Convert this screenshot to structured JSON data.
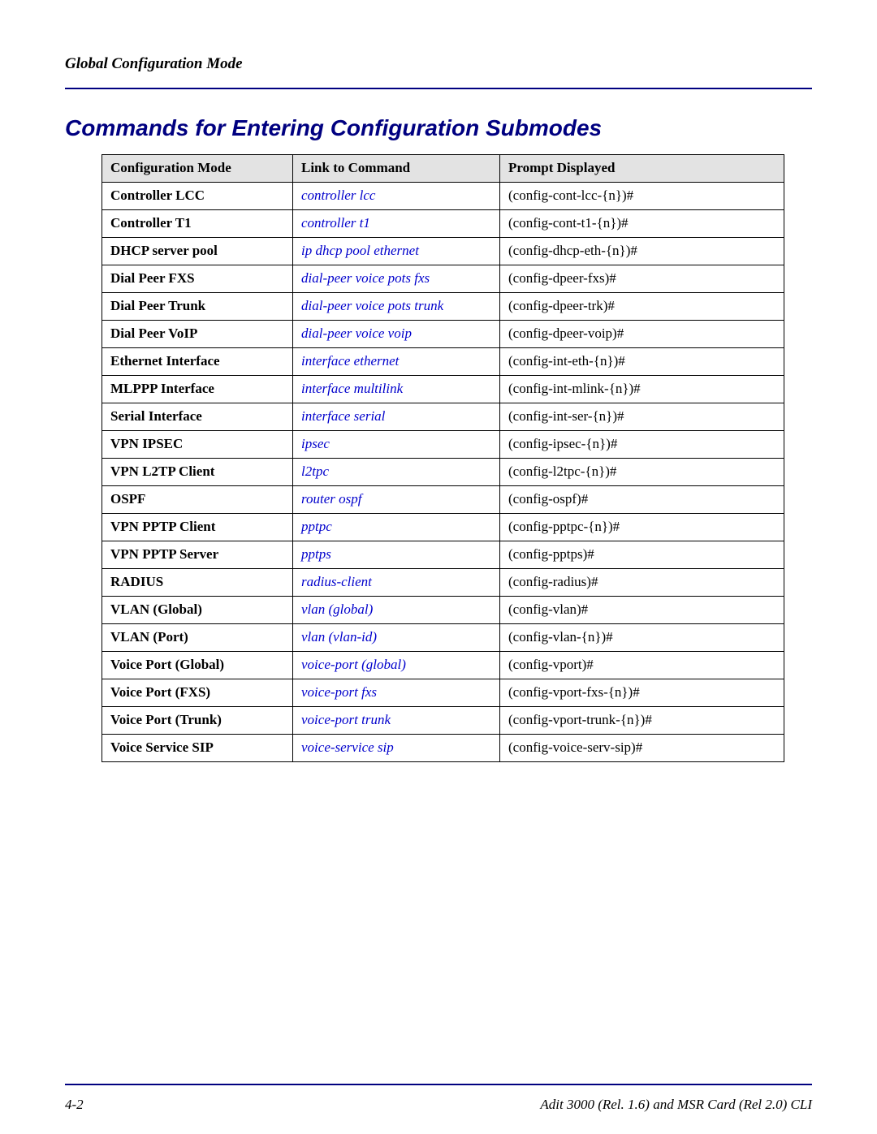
{
  "header": {
    "title": "Global Configuration Mode"
  },
  "section": {
    "heading": "Commands for Entering Configuration Submodes"
  },
  "table": {
    "headers": [
      "Configuration Mode",
      "Link to Command",
      "Prompt Displayed"
    ],
    "rows": [
      {
        "mode": "Controller LCC",
        "link": "controller lcc",
        "prompt": "(config-cont-lcc-{n})#"
      },
      {
        "mode": "Controller T1",
        "link": "controller t1",
        "prompt": "(config-cont-t1-{n})#"
      },
      {
        "mode": "DHCP server pool",
        "link": "ip dhcp pool ethernet",
        "prompt": "(config-dhcp-eth-{n})#"
      },
      {
        "mode": "Dial Peer FXS",
        "link": "dial-peer voice pots fxs",
        "prompt": "(config-dpeer-fxs)#"
      },
      {
        "mode": "Dial Peer Trunk",
        "link": "dial-peer voice pots trunk",
        "prompt": "(config-dpeer-trk)#"
      },
      {
        "mode": "Dial Peer VoIP",
        "link": "dial-peer voice voip",
        "prompt": "(config-dpeer-voip)#"
      },
      {
        "mode": "Ethernet Interface",
        "link": "interface ethernet",
        "prompt": "(config-int-eth-{n})#"
      },
      {
        "mode": "MLPPP Interface",
        "link": "interface multilink",
        "prompt": "(config-int-mlink-{n})#"
      },
      {
        "mode": "Serial Interface",
        "link": "interface serial",
        "prompt": "(config-int-ser-{n})#"
      },
      {
        "mode": "VPN IPSEC",
        "link": "ipsec",
        "prompt": "(config-ipsec-{n})#"
      },
      {
        "mode": "VPN L2TP Client",
        "link": "l2tpc",
        "prompt": "(config-l2tpc-{n})#"
      },
      {
        "mode": "OSPF",
        "link": "router ospf",
        "prompt": "(config-ospf)#"
      },
      {
        "mode": "VPN PPTP Client",
        "link": "pptpc",
        "prompt": "(config-pptpc-{n})#"
      },
      {
        "mode": "VPN PPTP Server",
        "link": "pptps",
        "prompt": "(config-pptps)#"
      },
      {
        "mode": "RADIUS",
        "link": "radius-client",
        "prompt": "(config-radius)#"
      },
      {
        "mode": "VLAN (Global)",
        "link": "vlan (global)",
        "prompt": "(config-vlan)#"
      },
      {
        "mode": "VLAN (Port)",
        "link": "vlan (vlan-id)",
        "prompt": "(config-vlan-{n})#"
      },
      {
        "mode": "Voice Port (Global)",
        "link": "voice-port (global)",
        "prompt": "(config-vport)#"
      },
      {
        "mode": "Voice Port (FXS)",
        "link": "voice-port fxs",
        "prompt": "(config-vport-fxs-{n})#"
      },
      {
        "mode": "Voice Port (Trunk)",
        "link": "voice-port trunk",
        "prompt": "(config-vport-trunk-{n})#"
      },
      {
        "mode": "Voice Service SIP",
        "link": "voice-service sip",
        "prompt": "(config-voice-serv-sip)#"
      }
    ]
  },
  "footer": {
    "page_number": "4-2",
    "doc_title": "Adit 3000 (Rel. 1.6) and MSR Card (Rel 2.0) CLI"
  }
}
